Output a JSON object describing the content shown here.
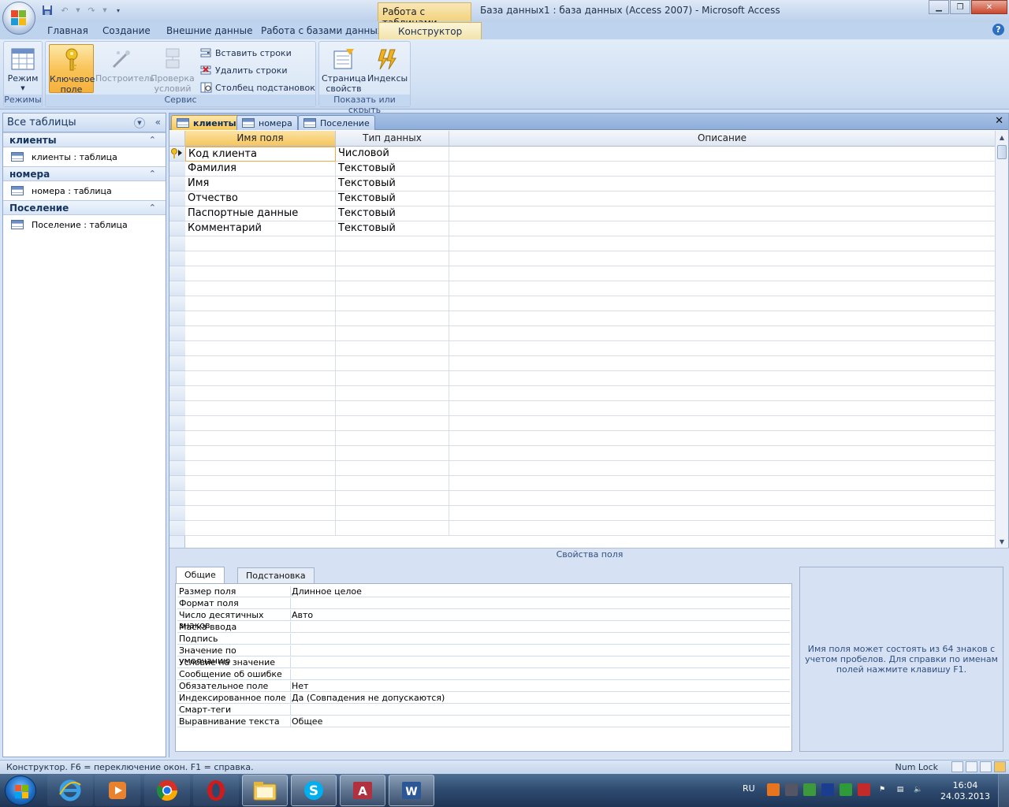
{
  "window": {
    "context_tab": "Работа с таблицами",
    "title": "База данных1 : база данных (Access 2007) - Microsoft Access",
    "controls": [
      "minimize",
      "restore",
      "close"
    ]
  },
  "ribbon_tabs": [
    "Главная",
    "Создание",
    "Внешние данные",
    "Работа с базами данных",
    "Конструктор"
  ],
  "active_ribbon_tab": "Конструктор",
  "ribbon": {
    "groups": {
      "modes": "Режимы",
      "service": "Сервис",
      "show_hide": "Показать или скрыть"
    },
    "mode_btn": "Режим",
    "key_btn": [
      "Ключевое",
      "поле"
    ],
    "builder_btn": "Построитель",
    "check_btn": [
      "Проверка",
      "условий"
    ],
    "insert_rows": "Вставить строки",
    "delete_rows": "Удалить строки",
    "lookup_col": "Столбец  подстановок",
    "prop_sheet_btn": [
      "Страница",
      "свойств"
    ],
    "indexes_btn": "Индексы"
  },
  "nav": {
    "header": "Все таблицы",
    "groups": [
      {
        "name": "клиенты",
        "item": "клиенты : таблица"
      },
      {
        "name": "номера",
        "item": "номера : таблица"
      },
      {
        "name": "Поселение",
        "item": "Поселение : таблица"
      }
    ]
  },
  "doc_tabs": [
    "клиенты",
    "номера",
    "Поселение"
  ],
  "active_doc_tab": "клиенты",
  "grid": {
    "headers": [
      "Имя поля",
      "Тип данных",
      "Описание"
    ],
    "rows": [
      {
        "name": "Код клиента",
        "type": "Числовой",
        "desc": ""
      },
      {
        "name": "Фамилия",
        "type": "Текстовый",
        "desc": ""
      },
      {
        "name": "Имя",
        "type": "Текстовый",
        "desc": ""
      },
      {
        "name": "Отчество",
        "type": "Текстовый",
        "desc": ""
      },
      {
        "name": "Паспортные данные",
        "type": "Текстовый",
        "desc": ""
      },
      {
        "name": "Комментарий",
        "type": "Текстовый",
        "desc": ""
      }
    ]
  },
  "field_props": {
    "title": "Свойства поля",
    "tabs": [
      "Общие",
      "Подстановка"
    ],
    "rows": [
      {
        "label": "Размер поля",
        "value": "Длинное целое"
      },
      {
        "label": "Формат поля",
        "value": ""
      },
      {
        "label": "Число десятичных знаков",
        "value": "Авто"
      },
      {
        "label": "Маска ввода",
        "value": ""
      },
      {
        "label": "Подпись",
        "value": ""
      },
      {
        "label": "Значение по умолчанию",
        "value": ""
      },
      {
        "label": "Условие на значение",
        "value": ""
      },
      {
        "label": "Сообщение об ошибке",
        "value": ""
      },
      {
        "label": "Обязательное поле",
        "value": "Нет"
      },
      {
        "label": "Индексированное поле",
        "value": "Да (Совпадения не допускаются)"
      },
      {
        "label": "Смарт-теги",
        "value": ""
      },
      {
        "label": "Выравнивание текста",
        "value": "Общее"
      }
    ],
    "hint": "Имя поля может состоять из 64 знаков с учетом пробелов.  Для справки по именам полей нажмите клавишу F1."
  },
  "statusbar": {
    "text": "Конструктор.  F6 = переключение окон.  F1 = справка.",
    "numlock": "Num Lock"
  },
  "taskbar": {
    "lang": "RU",
    "time": "16:04",
    "date": "24.03.2013"
  }
}
